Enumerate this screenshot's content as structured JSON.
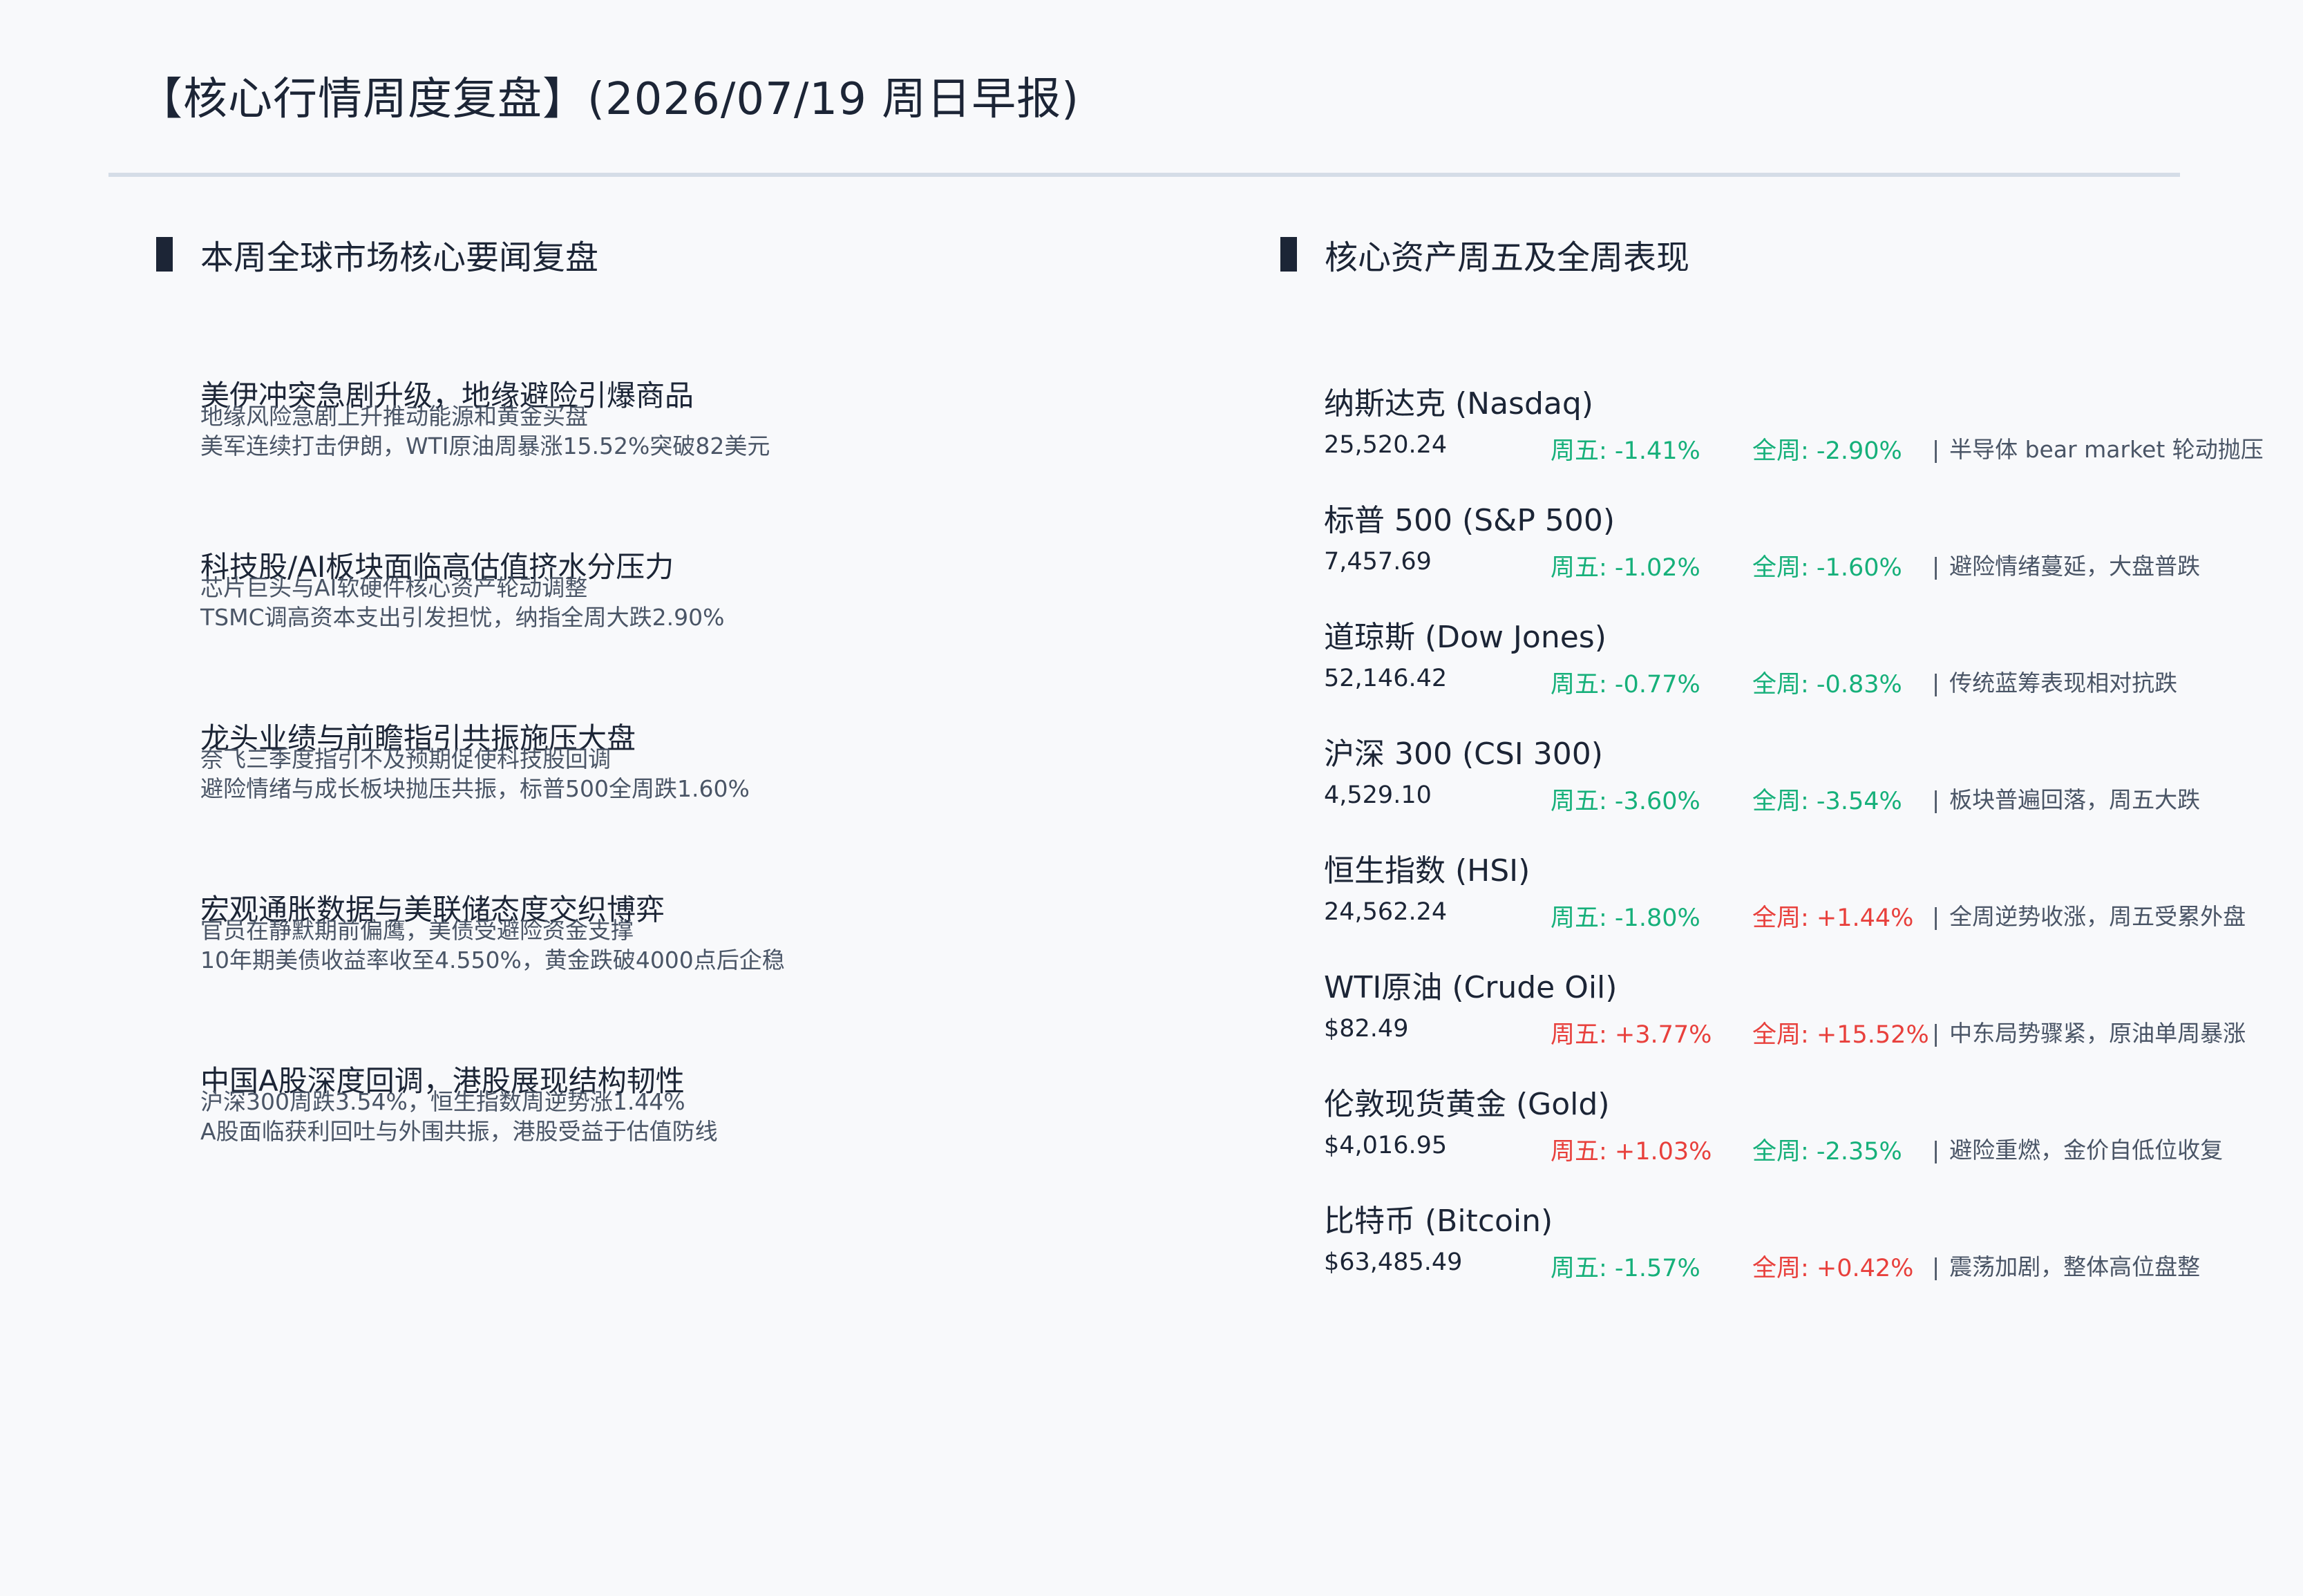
{
  "header": {
    "title": "【核心行情周度复盘】(2026/07/19 周日早报)"
  },
  "news_section": {
    "heading": "本周全球市场核心要闻复盘",
    "items": [
      {
        "title": "美伊冲突急剧升级，地缘避险引爆商品",
        "sub1": "地缘风险急剧上升推动能源和黄金买盘",
        "sub2": "美军连续打击伊朗，WTI原油周暴涨15.52%突破82美元"
      },
      {
        "title": "科技股/AI板块面临高估值挤水分压力",
        "sub1": "芯片巨头与AI软硬件核心资产轮动调整",
        "sub2": "TSMC调高资本支出引发担忧，纳指全周大跌2.90%"
      },
      {
        "title": "龙头业绩与前瞻指引共振施压大盘",
        "sub1": "奈飞三季度指引不及预期促使科技股回调",
        "sub2": "避险情绪与成长板块抛压共振，标普500全周跌1.60%"
      },
      {
        "title": "宏观通胀数据与美联储态度交织博弈",
        "sub1": "官员在静默期前偏鹰，美债受避险资金支撑",
        "sub2": "10年期美债收益率收至4.550%，黄金跌破4000点后企稳"
      },
      {
        "title": "中国A股深度回调，港股展现结构韧性",
        "sub1": "沪深300周跌3.54%，恒生指数周逆势涨1.44%",
        "sub2": "A股面临获利回吐与外围共振，港股受益于估值防线"
      }
    ]
  },
  "assets_section": {
    "heading": "核心资产周五及全周表现",
    "fri_prefix": "周五: ",
    "week_prefix": "全周: ",
    "note_bar": "|",
    "colors": {
      "down": "#16b07a",
      "up": "#e8403c"
    },
    "items": [
      {
        "name": "纳斯达克 (Nasdaq)",
        "price": "25,520.24",
        "fri": "-1.41%",
        "fri_dir": "down",
        "week": "-2.90%",
        "week_dir": "down",
        "note": "半导体 bear market 轮动抛压"
      },
      {
        "name": "标普 500 (S&P 500)",
        "price": "7,457.69",
        "fri": "-1.02%",
        "fri_dir": "down",
        "week": "-1.60%",
        "week_dir": "down",
        "note": "避险情绪蔓延，大盘普跌"
      },
      {
        "name": "道琼斯 (Dow Jones)",
        "price": "52,146.42",
        "fri": "-0.77%",
        "fri_dir": "down",
        "week": "-0.83%",
        "week_dir": "down",
        "note": "传统蓝筹表现相对抗跌"
      },
      {
        "name": "沪深 300 (CSI 300)",
        "price": "4,529.10",
        "fri": "-3.60%",
        "fri_dir": "down",
        "week": "-3.54%",
        "week_dir": "down",
        "note": "板块普遍回落，周五大跌"
      },
      {
        "name": "恒生指数 (HSI)",
        "price": "24,562.24",
        "fri": "-1.80%",
        "fri_dir": "down",
        "week": "+1.44%",
        "week_dir": "up",
        "note": "全周逆势收涨，周五受累外盘"
      },
      {
        "name": "WTI原油 (Crude Oil)",
        "price": "$82.49",
        "fri": "+3.77%",
        "fri_dir": "up",
        "week": "+15.52%",
        "week_dir": "up",
        "note": "中东局势骤紧，原油单周暴涨"
      },
      {
        "name": "伦敦现货黄金 (Gold)",
        "price": "$4,016.95",
        "fri": "+1.03%",
        "fri_dir": "up",
        "week": "-2.35%",
        "week_dir": "down",
        "note": "避险重燃，金价自低位收复"
      },
      {
        "name": "比特币 (Bitcoin)",
        "price": "$63,485.49",
        "fri": "-1.57%",
        "fri_dir": "down",
        "week": "+0.42%",
        "week_dir": "up",
        "note": "震荡加剧，整体高位盘整"
      }
    ]
  }
}
